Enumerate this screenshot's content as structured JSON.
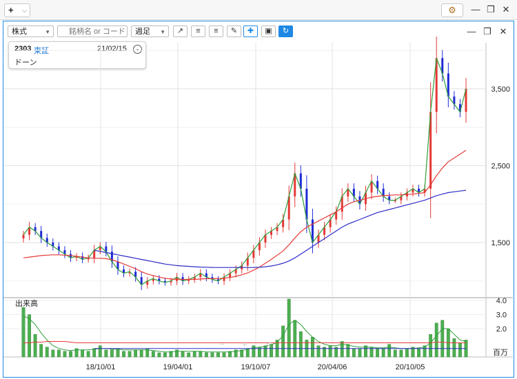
{
  "window": {
    "add_label": "+",
    "gear_icon": "gear-icon"
  },
  "toolbar": {
    "asset_type": "株式",
    "search_placeholder": "銘柄名 or コード",
    "interval": "週足"
  },
  "info": {
    "code": "2303",
    "market": "東証",
    "date": "21/02/15",
    "name": "ドーン"
  },
  "colors": {
    "up": "#e53935",
    "down": "#1e2ad6",
    "ma_short": "#2e9e3a",
    "ma_mid": "#e53935",
    "ma_long": "#2b2bc7",
    "volume": "#4caf50",
    "accent": "#1e88e5"
  },
  "chart_data": [
    {
      "type": "candlestick",
      "y_ticks": [
        "3,500",
        "2,500",
        "1,500"
      ],
      "y_tick_values": [
        3500,
        2500,
        1500
      ],
      "ylim": [
        800,
        4100
      ],
      "x_ticks": [
        "18/10/01",
        "19/04/01",
        "19/10/07",
        "20/04/06",
        "20/10/05"
      ],
      "grid": true,
      "series": [
        {
          "values": [
            1600,
            1700,
            1650,
            1560,
            1500,
            1450,
            1400,
            1350,
            1300,
            1320,
            1280,
            1300,
            1400,
            1450,
            1380,
            1250,
            1150,
            1100,
            1120,
            1050,
            950,
            1000,
            1030,
            1000,
            980,
            1000,
            1050,
            1000,
            1020,
            1050,
            1100,
            1050,
            1020,
            1000,
            1050,
            1100,
            1150,
            1200,
            1300,
            1400,
            1500,
            1600,
            1650,
            1700,
            1800,
            2100,
            2400,
            2200,
            1800,
            1500,
            1600,
            1700,
            1800,
            1900,
            2100,
            2200,
            2100,
            2000,
            2150,
            2300,
            2200,
            2100,
            2050,
            2050,
            2100,
            2150,
            2200,
            2150,
            2200,
            3200,
            3900,
            3700,
            3400,
            3300,
            3200,
            3500
          ]
        },
        {
          "values": [
            1300,
            1310,
            1320,
            1330,
            1335,
            1340,
            1340,
            1335,
            1330,
            1320,
            1310,
            1300,
            1295,
            1295,
            1290,
            1275,
            1250,
            1220,
            1190,
            1160,
            1120,
            1090,
            1070,
            1050,
            1035,
            1025,
            1020,
            1020,
            1020,
            1020,
            1025,
            1030,
            1030,
            1030,
            1035,
            1045,
            1060,
            1080,
            1105,
            1140,
            1180,
            1230,
            1280,
            1335,
            1390,
            1470,
            1560,
            1640,
            1700,
            1740,
            1780,
            1820,
            1860,
            1900,
            1950,
            2000,
            2030,
            2050,
            2070,
            2090,
            2100,
            2110,
            2115,
            2120,
            2120,
            2125,
            2130,
            2140,
            2150,
            2250,
            2370,
            2470,
            2550,
            2600,
            2650,
            2700
          ]
        },
        {
          "values": [
            null,
            null,
            null,
            null,
            null,
            null,
            null,
            null,
            null,
            null,
            null,
            null,
            1400,
            1385,
            1370,
            1355,
            1340,
            1325,
            1310,
            1295,
            1280,
            1265,
            1250,
            1235,
            1220,
            1210,
            1200,
            1195,
            1190,
            1185,
            1180,
            1178,
            1176,
            1175,
            1175,
            1175,
            1175,
            1175,
            1175,
            1176,
            1178,
            1185,
            1195,
            1210,
            1230,
            1260,
            1300,
            1350,
            1400,
            1450,
            1500,
            1550,
            1600,
            1650,
            1700,
            1740,
            1770,
            1800,
            1830,
            1860,
            1890,
            1910,
            1930,
            1950,
            1970,
            1990,
            2010,
            2030,
            2050,
            2080,
            2110,
            2130,
            2150,
            2160,
            2170,
            2180
          ]
        }
      ]
    },
    {
      "type": "bar",
      "label": "出来高",
      "unit": "百万",
      "y_ticks": [
        "4.0",
        "3.0",
        "2.0"
      ],
      "y_tick_values": [
        4.0,
        3.0,
        2.0
      ],
      "ylim": [
        0,
        4.1
      ],
      "values": [
        3.5,
        3.0,
        1.6,
        0.9,
        0.7,
        0.5,
        0.5,
        0.4,
        0.4,
        0.6,
        0.5,
        0.4,
        0.6,
        0.8,
        0.5,
        0.5,
        0.6,
        0.4,
        0.4,
        0.5,
        0.5,
        0.6,
        0.4,
        0.3,
        0.3,
        0.4,
        0.5,
        0.4,
        0.3,
        0.4,
        0.4,
        0.3,
        0.3,
        0.3,
        0.3,
        0.4,
        0.5,
        0.5,
        0.6,
        0.8,
        0.7,
        0.8,
        0.9,
        1.2,
        2.2,
        4.1,
        2.6,
        1.8,
        1.2,
        1.4,
        0.8,
        0.7,
        0.8,
        0.7,
        1.1,
        0.9,
        0.6,
        0.6,
        0.8,
        0.7,
        0.6,
        0.6,
        0.9,
        0.5,
        0.5,
        0.6,
        0.7,
        0.6,
        0.8,
        1.6,
        2.4,
        2.6,
        2.0,
        1.3,
        1.0,
        1.2
      ],
      "series": [
        {
          "values": [
            2.9,
            2.7,
            2.3,
            1.7,
            1.2,
            0.8,
            0.6,
            0.5,
            0.45,
            0.5,
            0.5,
            0.5,
            0.55,
            0.6,
            0.6,
            0.55,
            0.55,
            0.5,
            0.5,
            0.5,
            0.5,
            0.5,
            0.45,
            0.4,
            0.35,
            0.35,
            0.4,
            0.4,
            0.4,
            0.4,
            0.4,
            0.35,
            0.35,
            0.35,
            0.35,
            0.35,
            0.4,
            0.45,
            0.55,
            0.65,
            0.7,
            0.75,
            0.85,
            1.05,
            1.5,
            2.3,
            2.6,
            2.3,
            1.8,
            1.4,
            1.1,
            0.9,
            0.8,
            0.8,
            0.9,
            0.85,
            0.75,
            0.7,
            0.7,
            0.7,
            0.65,
            0.65,
            0.7,
            0.65,
            0.6,
            0.6,
            0.6,
            0.65,
            0.7,
            1.0,
            1.5,
            2.0,
            2.0,
            1.6,
            1.2,
            1.1
          ]
        },
        {
          "values": [
            1.0,
            1.0,
            1.05,
            1.05,
            1.1,
            1.1,
            1.1,
            1.1,
            1.05,
            1.0,
            1.0,
            1.0,
            1.0,
            1.0,
            1.0,
            1.0,
            1.0,
            1.0,
            1.0,
            1.0,
            1.0,
            1.0,
            1.0,
            1.0,
            1.0,
            1.0,
            1.0,
            1.0,
            1.0,
            1.0,
            1.0,
            1.0,
            1.0,
            1.0,
            1.0,
            1.0,
            1.0,
            1.0,
            1.0,
            1.0,
            1.0,
            1.0,
            1.0,
            1.0,
            1.0,
            1.0,
            1.0,
            1.0,
            1.0,
            1.0,
            1.0,
            1.0,
            1.0,
            1.0,
            1.0,
            1.0,
            1.0,
            1.0,
            1.0,
            1.0,
            1.0,
            1.0,
            1.0,
            1.0,
            1.0,
            1.0,
            1.0,
            1.0,
            1.0,
            1.0,
            1.05,
            1.05,
            1.0,
            1.0,
            1.0,
            1.0
          ]
        },
        {
          "values": [
            null,
            null,
            null,
            null,
            null,
            null,
            null,
            null,
            null,
            null,
            null,
            null,
            0.6,
            0.6,
            0.6,
            0.6,
            0.6,
            0.6,
            0.6,
            0.6,
            0.6,
            0.6,
            0.6,
            0.6,
            0.6,
            0.6,
            0.6,
            0.6,
            0.6,
            0.6,
            0.6,
            0.6,
            0.6,
            0.6,
            0.6,
            0.6,
            0.6,
            0.6,
            0.6,
            0.6,
            0.6,
            0.6,
            0.6,
            0.6,
            0.6,
            0.6,
            0.6,
            0.6,
            0.6,
            0.6,
            0.6,
            0.6,
            0.6,
            0.6,
            0.6,
            0.6,
            0.6,
            0.6,
            0.6,
            0.6,
            0.6,
            0.6,
            0.6,
            0.6,
            0.6,
            0.6,
            0.6,
            0.6,
            0.6,
            0.6,
            0.6,
            0.6,
            0.6,
            0.6,
            0.6,
            0.6
          ]
        }
      ]
    }
  ]
}
